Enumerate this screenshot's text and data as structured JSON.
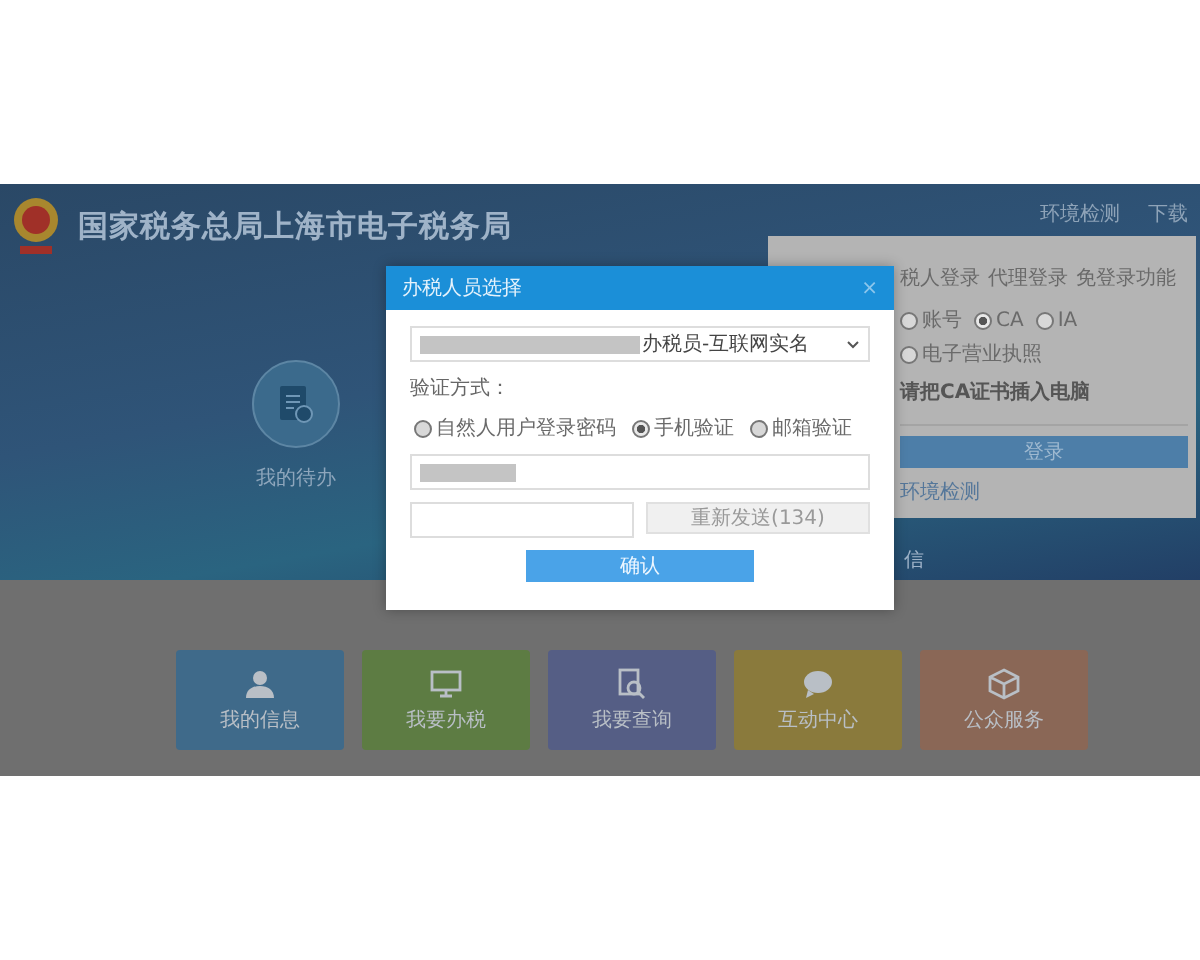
{
  "site": {
    "title": "国家税务总局上海市电子税务局",
    "top_links": [
      "环境检测",
      "下载"
    ]
  },
  "banner": {
    "todo_label": "我的待办",
    "partial_label": "信"
  },
  "login_panel": {
    "tabs": [
      {
        "label": "税人登录",
        "selected": false
      },
      {
        "label": "代理登录",
        "selected": false
      },
      {
        "label": "免登录功能",
        "selected": false
      }
    ],
    "methods": [
      {
        "label": "账号",
        "selected": false
      },
      {
        "label": "CA",
        "selected": true
      },
      {
        "label": "IA",
        "selected": false
      },
      {
        "label": "电子营业执照",
        "selected": false
      }
    ],
    "prompt": "请把CA证书插入电脑",
    "button": "登录",
    "link": "环境检测"
  },
  "tiles": [
    {
      "label": "我的信息",
      "color": "#3f6a8a",
      "kind": "person"
    },
    {
      "label": "我要办税",
      "color": "#5d7c43",
      "kind": "monitor"
    },
    {
      "label": "我要查询",
      "color": "#555e85",
      "kind": "search"
    },
    {
      "label": "互动中心",
      "color": "#8a7a3c",
      "kind": "chat"
    },
    {
      "label": "公众服务",
      "color": "#8a6756",
      "kind": "box"
    }
  ],
  "dialog": {
    "title": "办税人员选择",
    "close": "×",
    "select_value": "办税员-互联网实名",
    "verify_label": "验证方式：",
    "verify_options": [
      {
        "label": "自然人用户登录密码",
        "selected": false
      },
      {
        "label": "手机验证",
        "selected": true
      },
      {
        "label": "邮箱验证",
        "selected": false
      }
    ],
    "resend_button": "重新发送(134)",
    "confirm": "确认"
  }
}
